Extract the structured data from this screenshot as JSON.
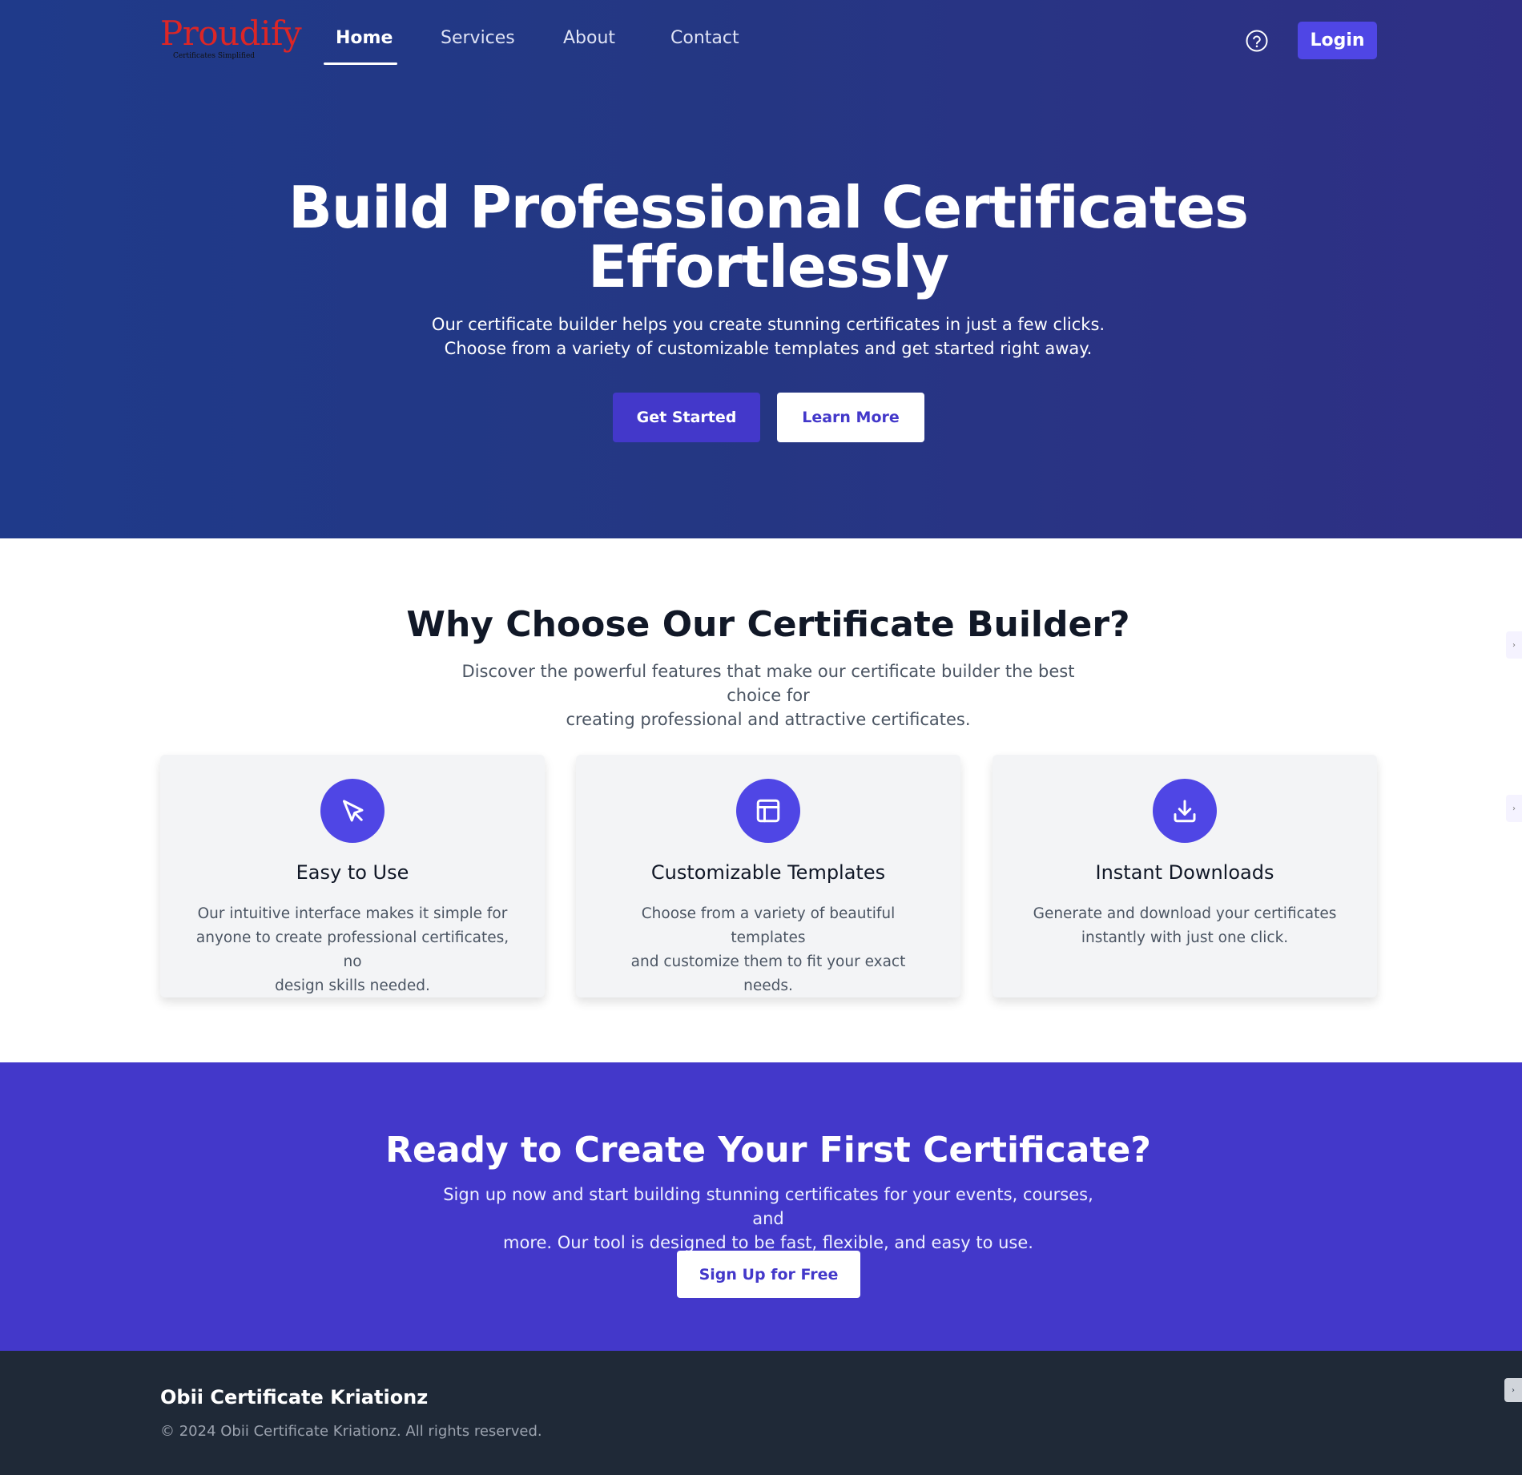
{
  "nav": {
    "logo_text": "Proudify",
    "logo_tagline": "Certificates Simplified",
    "links": [
      {
        "label": "Home",
        "active": true
      },
      {
        "label": "Services",
        "active": false
      },
      {
        "label": "About",
        "active": false
      },
      {
        "label": "Contact",
        "active": false
      }
    ],
    "help_icon": "question-circle-icon",
    "login_label": "Login"
  },
  "hero": {
    "title_line1": "Build Professional Certificates",
    "title_line2": "Effortlessly",
    "subtitle_line1": "Our certificate builder helps you create stunning certificates in just a few clicks.",
    "subtitle_line2": "Choose from a variety of customizable templates and get started right away.",
    "primary_button": "Get Started",
    "secondary_button": "Learn More"
  },
  "features": {
    "title": "Why Choose Our Certificate Builder?",
    "subtitle_line1": "Discover the powerful features that make our certificate builder the best choice for",
    "subtitle_line2": "creating professional and attractive certificates.",
    "cards": [
      {
        "icon": "cursor-click-icon",
        "title": "Easy to Use",
        "lines": [
          "Our intuitive interface makes it simple for",
          "anyone to create professional certificates, no",
          "design skills needed."
        ]
      },
      {
        "icon": "template-layout-icon",
        "title": "Customizable Templates",
        "lines": [
          "Choose from a variety of beautiful templates",
          "and customize them to fit your exact needs."
        ]
      },
      {
        "icon": "download-icon",
        "title": "Instant Downloads",
        "lines": [
          "Generate and download your certificates",
          "instantly with just one click."
        ]
      }
    ]
  },
  "cta": {
    "title": "Ready to Create Your First Certificate?",
    "subtitle_line1": "Sign up now and start building stunning certificates for your events, courses, and",
    "subtitle_line2": "more. Our tool is designed to be fast, flexible, and easy to use.",
    "button": "Sign Up for Free"
  },
  "footer": {
    "title": "Obii Certificate Kriationz",
    "copyright": "© 2024 Obii Certificate Kriationz. All rights reserved."
  },
  "colors": {
    "accent": "#4f46e5",
    "cta_bg": "#4338ca",
    "footer_bg": "#1f2937",
    "logo": "#dc2626"
  }
}
